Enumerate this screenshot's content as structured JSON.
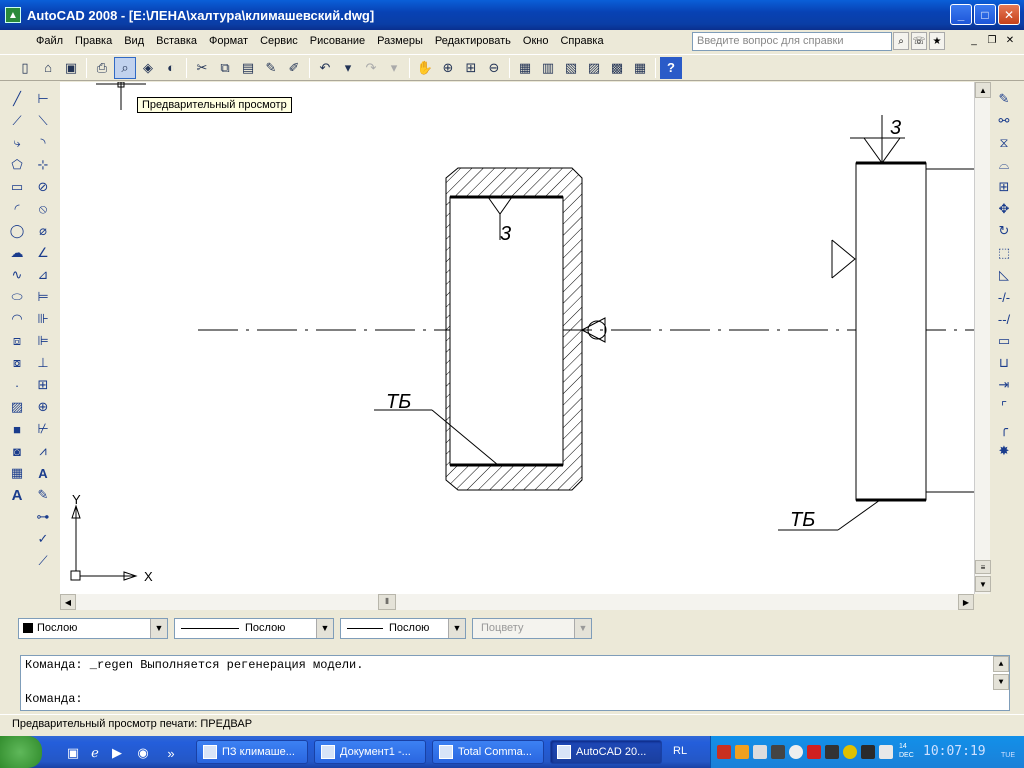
{
  "window": {
    "title": "AutoCAD 2008 - [E:\\ЛЕНА\\халтура\\климашевский.dwg]"
  },
  "menu": [
    "Файл",
    "Правка",
    "Вид",
    "Вставка",
    "Формат",
    "Сервис",
    "Рисование",
    "Размеры",
    "Редактировать",
    "Окно",
    "Справка"
  ],
  "help": {
    "placeholder": "Введите вопрос для справки"
  },
  "tooltip": "Предварительный просмотр",
  "drawing": {
    "label_tb1": "ТБ",
    "label_tb2": "ТБ",
    "label_3a": "3",
    "label_3b": "3",
    "ucs_x": "X",
    "ucs_y": "Y"
  },
  "properties": {
    "color": "Послою",
    "linetype": "Послою",
    "lineweight": "Послою",
    "plotstyle": "Поцвету"
  },
  "command": {
    "history": "Команда:  _regen Выполняется регенерация модели.",
    "prompt": "Команда:"
  },
  "status": "Предварительный просмотр печати: ПРЕДВАР",
  "taskbar": {
    "tasks": [
      "ПЗ климаше...",
      "Документ1 -...",
      "Total Comma...",
      "AutoCAD 20..."
    ],
    "lang": "RL",
    "clock": "10:07:19",
    "date_top": "14",
    "date_bottom": "DEC",
    "day": "TUE"
  }
}
